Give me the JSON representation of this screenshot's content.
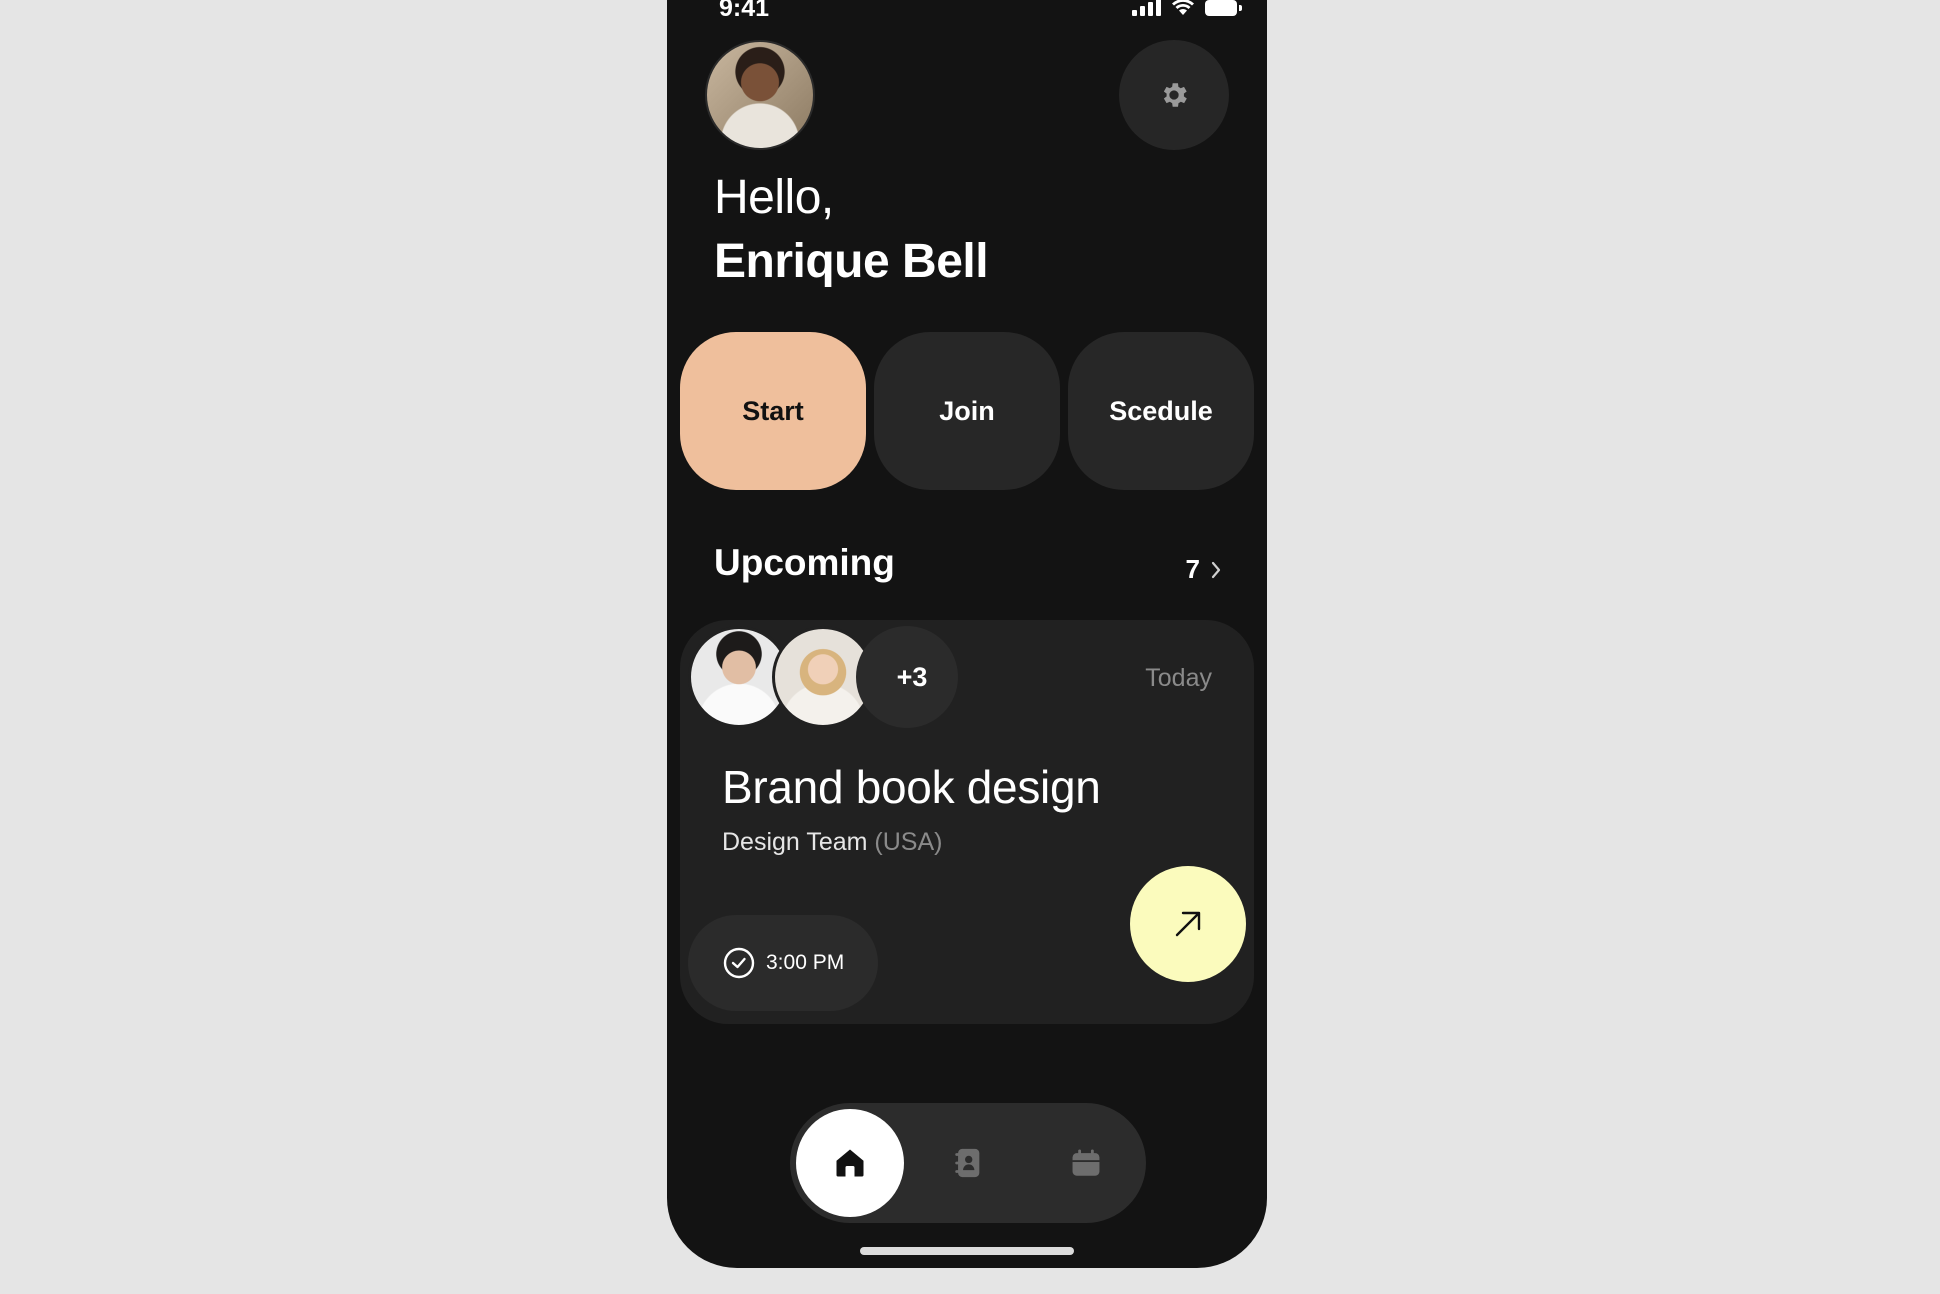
{
  "status_bar": {
    "time": "9:41"
  },
  "header": {
    "greeting": "Hello,",
    "user_name": "Enrique Bell",
    "avatar_icon": "user-avatar",
    "settings_icon": "gear-icon"
  },
  "actions": [
    {
      "label": "Start",
      "active": true
    },
    {
      "label": "Join"
    },
    {
      "label": "Scedule"
    }
  ],
  "upcoming": {
    "title": "Upcoming",
    "count": "7",
    "meeting": {
      "participants_more": "+3",
      "date": "Today",
      "title": "Brand book design",
      "team": "Design Team",
      "location": "(USA)",
      "time": "3:00 PM"
    }
  },
  "bottom_nav": {
    "items": [
      {
        "icon": "home-icon",
        "active": true
      },
      {
        "icon": "contacts-icon"
      },
      {
        "icon": "calendar-icon"
      }
    ]
  },
  "colors": {
    "background": "#e5e5e5",
    "phone": "#131313",
    "accent_start": "#efbf9c",
    "accent_open": "#fbfbbd",
    "card": "#212121"
  }
}
